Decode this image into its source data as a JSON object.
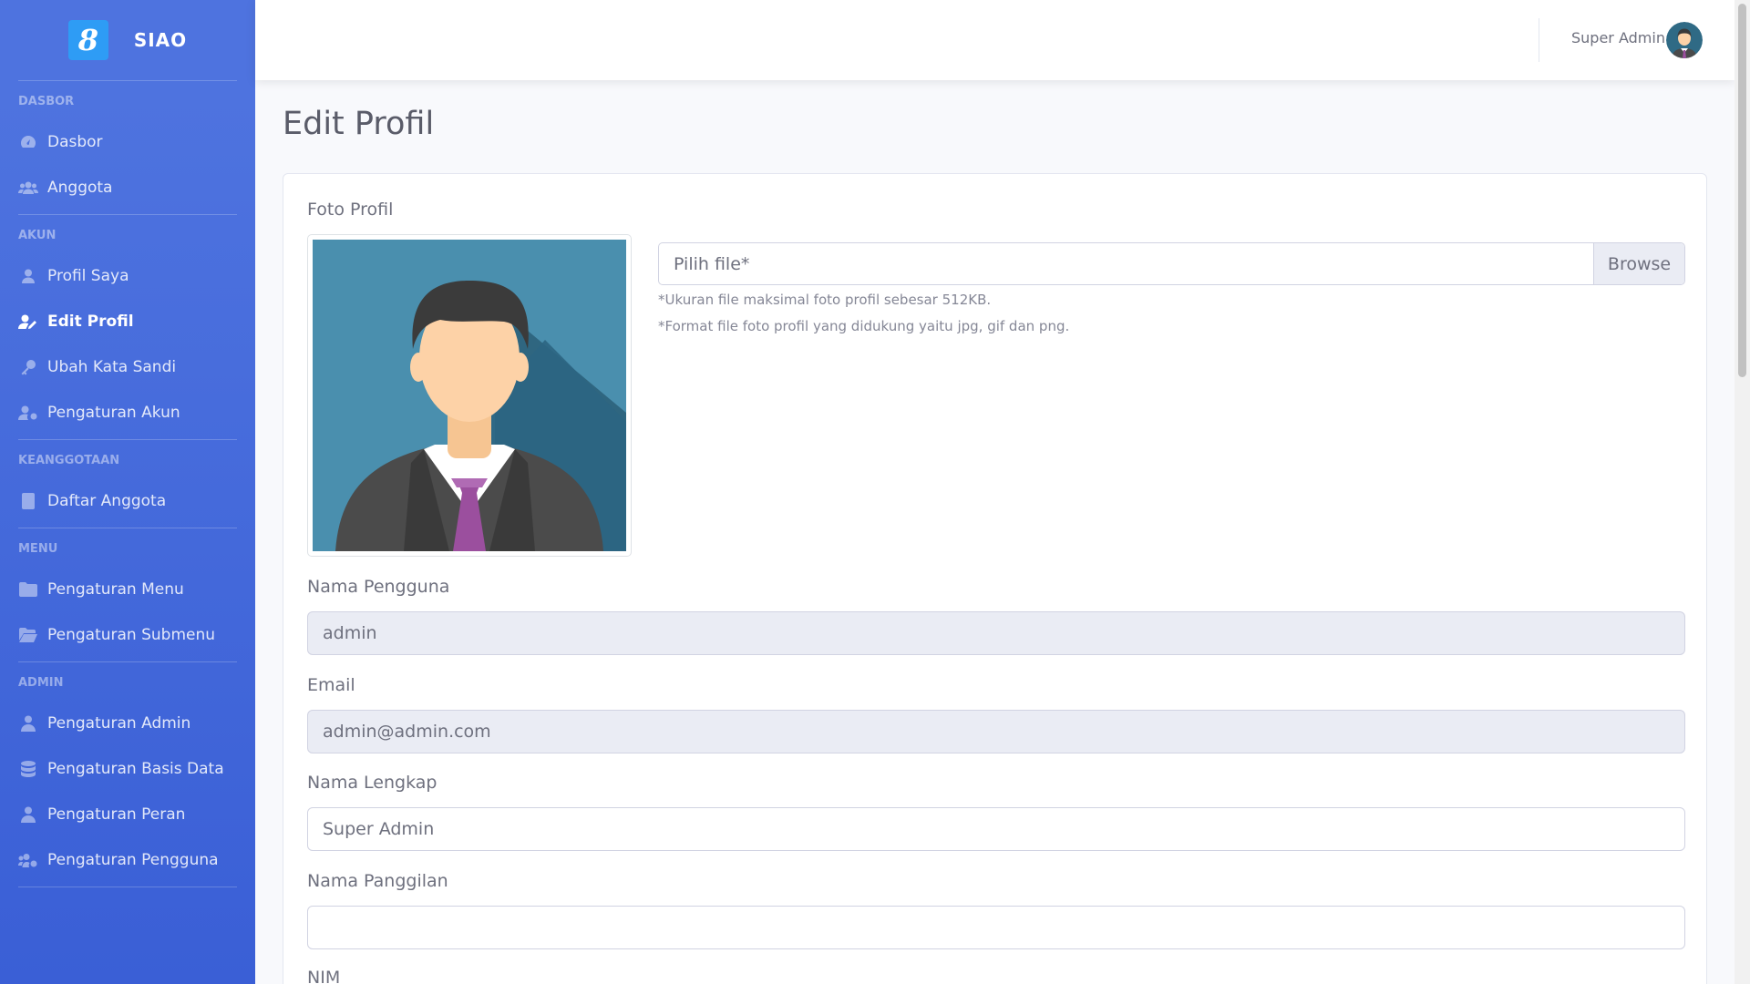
{
  "brand": {
    "name": "SIAO",
    "logo_glyph": "8"
  },
  "sidebar": {
    "sections": [
      {
        "heading": "DASBOR",
        "items": [
          {
            "label": "Dasbor",
            "icon": "tachometer-icon"
          },
          {
            "label": "Anggota",
            "icon": "users-icon"
          }
        ]
      },
      {
        "heading": "AKUN",
        "items": [
          {
            "label": "Profil Saya",
            "icon": "user-icon"
          },
          {
            "label": "Edit Profil",
            "icon": "user-edit-icon",
            "active": true
          },
          {
            "label": "Ubah Kata Sandi",
            "icon": "key-icon"
          },
          {
            "label": "Pengaturan Akun",
            "icon": "user-cog-icon"
          }
        ]
      },
      {
        "heading": "KEANGGOTAAN",
        "items": [
          {
            "label": "Daftar Anggota",
            "icon": "address-book-icon"
          }
        ]
      },
      {
        "heading": "MENU",
        "items": [
          {
            "label": "Pengaturan Menu",
            "icon": "folder-icon"
          },
          {
            "label": "Pengaturan Submenu",
            "icon": "folder-open-icon"
          }
        ]
      },
      {
        "heading": "ADMIN",
        "items": [
          {
            "label": "Pengaturan Admin",
            "icon": "user-tie-icon"
          },
          {
            "label": "Pengaturan Basis Data",
            "icon": "database-icon"
          },
          {
            "label": "Pengaturan Peran",
            "icon": "user-tag-icon"
          },
          {
            "label": "Pengaturan Pengguna",
            "icon": "users-cog-icon"
          }
        ]
      }
    ]
  },
  "topbar": {
    "user_name": "Super Admin"
  },
  "page": {
    "title": "Edit Profil"
  },
  "form": {
    "photo_label": "Foto Profil",
    "file_placeholder": "Pilih file*",
    "browse_label": "Browse",
    "help_size": "*Ukuran file maksimal foto profil sebesar 512KB.",
    "help_format": "*Format file foto profil yang didukung yaitu jpg, gif dan png.",
    "username_label": "Nama Pengguna",
    "username_value": "admin",
    "email_label": "Email",
    "email_value": "admin@admin.com",
    "fullname_label": "Nama Lengkap",
    "fullname_value": "Super Admin",
    "nickname_label": "Nama Panggilan",
    "nickname_value": "",
    "nim_label": "NIM"
  },
  "colors": {
    "sidebar": "#4e73df",
    "avatar_bg": "#4a8fae",
    "tie": "#9b4f9e"
  }
}
